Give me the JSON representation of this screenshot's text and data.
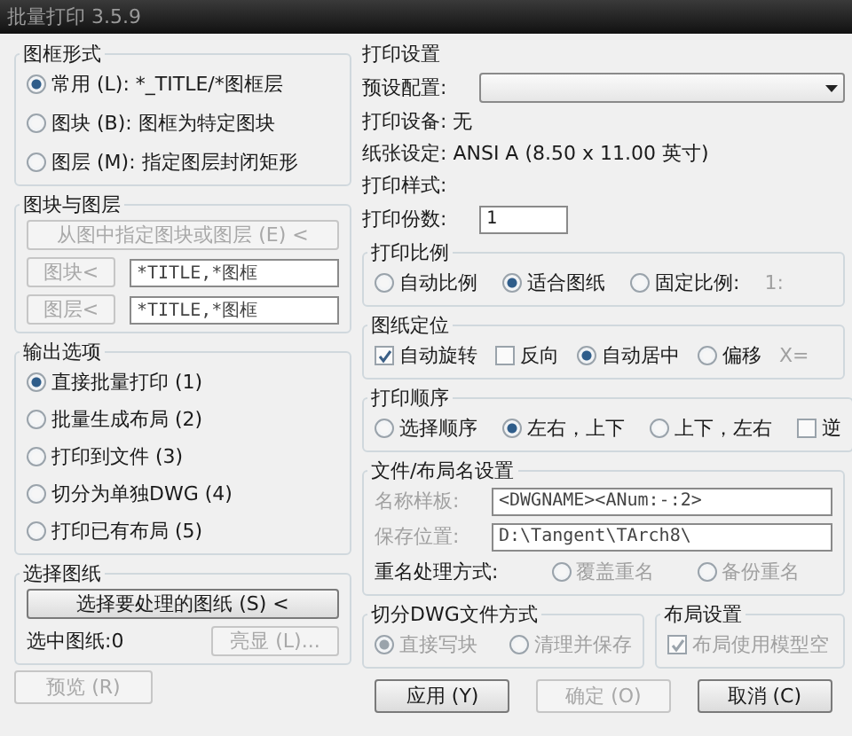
{
  "window": {
    "title": "批量打印 3.5.9"
  },
  "frame_style": {
    "title": "图框形式",
    "options": [
      {
        "label": "常用 (L): *_TITLE/*图框层",
        "selected": true
      },
      {
        "label": "图块 (B): 图框为特定图块",
        "selected": false
      },
      {
        "label": "图层 (M): 指定图层封闭矩形",
        "selected": false
      }
    ]
  },
  "block_layer": {
    "title": "图块与图层",
    "pick_button": {
      "label": "从图中指定图块或图层 (E) <",
      "disabled": true
    },
    "rows": [
      {
        "button": "图块<",
        "value": "*TITLE,*图框",
        "disabled": true
      },
      {
        "button": "图层<",
        "value": "*TITLE,*图框",
        "disabled": true
      }
    ]
  },
  "output": {
    "title": "输出选项",
    "options": [
      {
        "label": "直接批量打印 (1)",
        "selected": true
      },
      {
        "label": "批量生成布局 (2)",
        "selected": false
      },
      {
        "label": "打印到文件 (3)",
        "selected": false
      },
      {
        "label": "切分为单独DWG (4)",
        "selected": false
      },
      {
        "label": "打印已有布局 (5)",
        "selected": false
      }
    ]
  },
  "select_drawings": {
    "title": "选择图纸",
    "button": "选择要处理的图纸 (S) <",
    "count": "选中图纸:0",
    "highlight_button": {
      "label": "亮显 (L)...",
      "disabled": true
    }
  },
  "preview_button": {
    "label": "预览 (R)",
    "disabled": true
  },
  "print_settings": {
    "title": "打印设置",
    "preset_label": "预设配置:",
    "device": "打印设备: 无",
    "paper": "纸张设定: ANSI A (8.50 x 11.00 英寸)",
    "style": "打印样式:",
    "copies": {
      "label": "打印份数:",
      "value": "1"
    }
  },
  "scale": {
    "title": "打印比例",
    "items": [
      {
        "kind": "radio",
        "label": "自动比例",
        "selected": false
      },
      {
        "kind": "radio",
        "label": "适合图纸",
        "selected": true
      },
      {
        "kind": "radio",
        "label": "固定比例:",
        "selected": false
      },
      {
        "kind": "label",
        "label": "1:",
        "disabled": true
      }
    ]
  },
  "position": {
    "title": "图纸定位",
    "items": [
      {
        "kind": "checkbox",
        "label": "自动旋转",
        "checked": true
      },
      {
        "kind": "checkbox",
        "label": "反向",
        "checked": false
      },
      {
        "kind": "radio",
        "label": "自动居中",
        "selected": true
      },
      {
        "kind": "radio",
        "label": "偏移",
        "selected": false
      },
      {
        "kind": "label",
        "label": "X=",
        "disabled": true
      }
    ]
  },
  "order": {
    "title": "打印顺序",
    "items": [
      {
        "kind": "radio",
        "label": "选择顺序",
        "selected": false
      },
      {
        "kind": "radio",
        "label": "左右，上下",
        "selected": true
      },
      {
        "kind": "radio",
        "label": "上下，左右",
        "selected": false
      },
      {
        "kind": "checkbox",
        "label": "逆",
        "checked": false
      }
    ]
  },
  "file_names": {
    "title": "文件/布局名设置",
    "template": {
      "label": "名称样板:",
      "value": "<DWGNAME><ANum:-:2>",
      "disabled": true
    },
    "save_path": {
      "label": "保存位置:",
      "value": "D:\\Tangent\\TArch8\\",
      "disabled": true
    },
    "rename": {
      "label": "重名处理方式:",
      "items": [
        {
          "kind": "radio",
          "label": "覆盖重名",
          "selected": false,
          "disabled": true
        },
        {
          "kind": "radio",
          "label": "备份重名",
          "selected": false,
          "disabled": true
        }
      ]
    }
  },
  "split": {
    "title": "切分DWG文件方式",
    "items": [
      {
        "kind": "radio",
        "label": "直接写块",
        "selected": true,
        "disabled": true
      },
      {
        "kind": "radio",
        "label": "清理并保存",
        "selected": false,
        "disabled": true
      }
    ]
  },
  "layout": {
    "title": "布局设置",
    "items": [
      {
        "kind": "checkbox",
        "label": "布局使用模型空",
        "checked": true,
        "disabled": true
      }
    ]
  },
  "buttons": [
    {
      "label": "应用 (Y)",
      "disabled": false
    },
    {
      "label": "确定 (O)",
      "disabled": true
    },
    {
      "label": "取消 (C)",
      "disabled": false
    }
  ]
}
